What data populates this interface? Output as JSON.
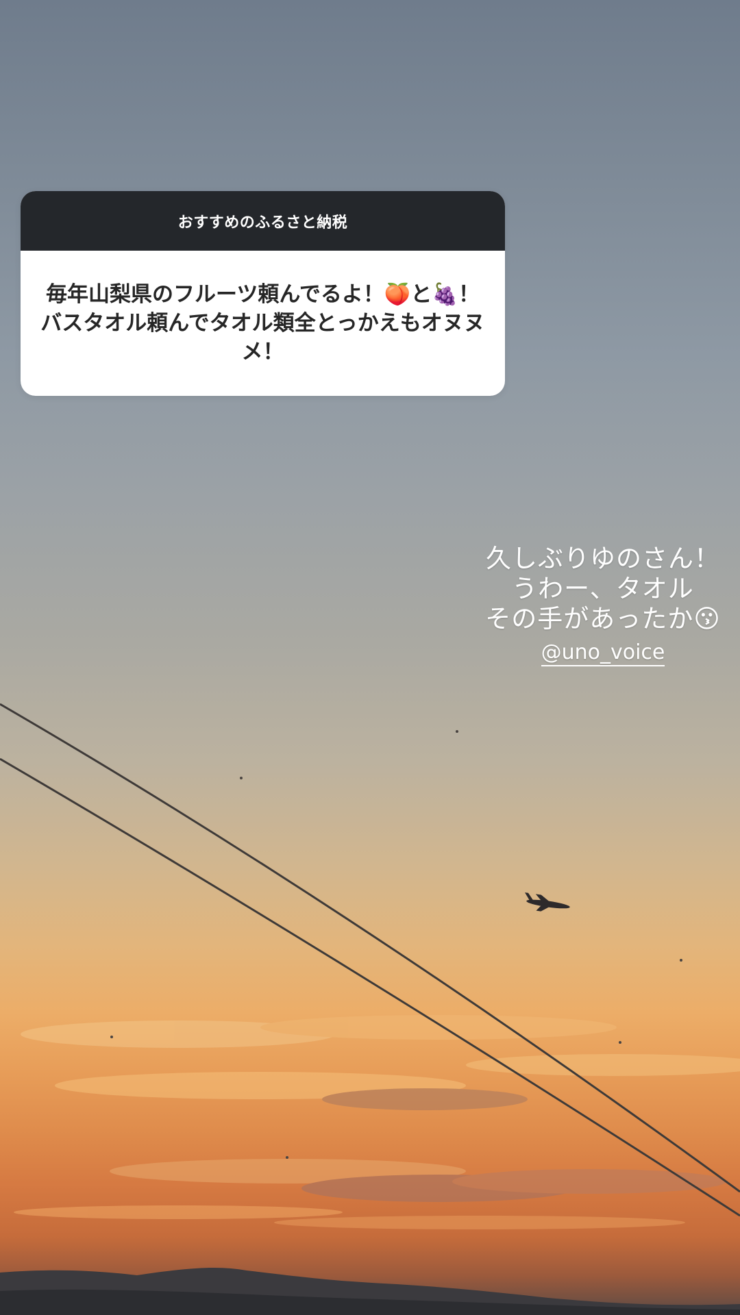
{
  "question_sticker": {
    "header": "おすすめのふるさと納税",
    "answer": "毎年山梨県のフルーツ頼んでるよ！🍑と🍇！バスタオル頼んでタオル類全とっかえもオヌヌメ！"
  },
  "caption": {
    "lines": [
      "久しぶりゆのさん！",
      "うわー、タオル",
      "その手があったか😗"
    ],
    "mention": "@uno_voice"
  },
  "background": {
    "scene": "sunset-sky",
    "objects": [
      "power-lines",
      "airplane",
      "mountains"
    ]
  },
  "colors": {
    "sticker_header": "#24272b",
    "sticker_body": "#ffffff",
    "answer_text": "#262626",
    "caption_text": "#ffffff"
  }
}
